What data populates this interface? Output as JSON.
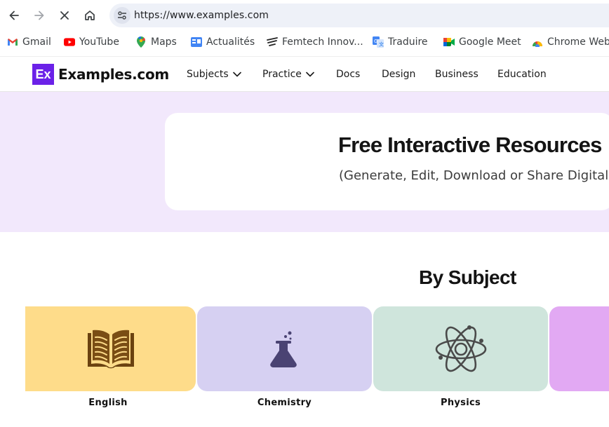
{
  "browser": {
    "url": "https://www.examples.com",
    "bookmarks": [
      {
        "label": "Gmail",
        "icon": "gmail-icon"
      },
      {
        "label": "YouTube",
        "icon": "youtube-icon"
      },
      {
        "label": "Maps",
        "icon": "maps-icon"
      },
      {
        "label": "Actualités",
        "icon": "news-icon"
      },
      {
        "label": "Femtech Innov...",
        "icon": "femtech-icon"
      },
      {
        "label": "Traduire",
        "icon": "translate-icon"
      },
      {
        "label": "Google Meet",
        "icon": "meet-icon"
      },
      {
        "label": "Chrome Web",
        "icon": "chrome-web-store-icon"
      }
    ]
  },
  "site": {
    "logo_mark": "Ex",
    "logo_text": "Examples.com",
    "brand_color": "#6b21e8",
    "nav": [
      {
        "label": "Subjects",
        "has_dropdown": true
      },
      {
        "label": "Practice",
        "has_dropdown": true
      },
      {
        "label": "Docs",
        "has_dropdown": false
      },
      {
        "label": "Design",
        "has_dropdown": false
      },
      {
        "label": "Business",
        "has_dropdown": false
      },
      {
        "label": "Education",
        "has_dropdown": false
      }
    ]
  },
  "hero": {
    "title": "Free Interactive Resources",
    "subtitle": "(Generate, Edit, Download or Share Digitally)",
    "background": "#f2e8fc"
  },
  "subjects": {
    "title": "By Subject",
    "cards": [
      {
        "label": "English",
        "icon": "book-icon",
        "color": "#fedc8a"
      },
      {
        "label": "Chemistry",
        "icon": "flask-icon",
        "color": "#d6d0f2"
      },
      {
        "label": "Physics",
        "icon": "atom-icon",
        "color": "#cfe5dc"
      },
      {
        "label": "",
        "icon": "",
        "color": "#e2a9f3"
      }
    ]
  }
}
